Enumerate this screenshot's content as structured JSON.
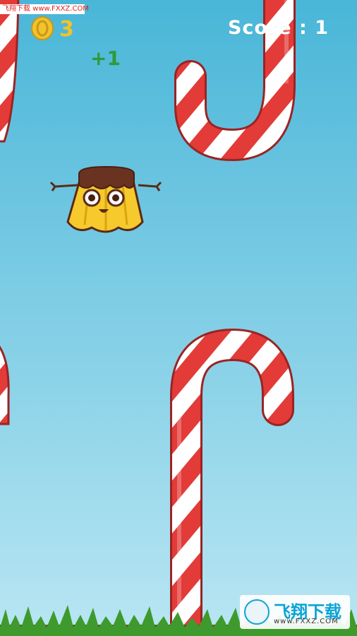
{
  "hud": {
    "coins": "3",
    "score": "Score : 1",
    "bonus": "+1"
  },
  "watermark": {
    "top_text": "飞翔下载 www.FXXZ.COM",
    "brand": "飞翔下载",
    "url": "www.FXXZ.COM"
  },
  "colors": {
    "sky_top": "#49b6d8",
    "sky_bottom": "#b9e6f3",
    "cane_red": "#e23b38",
    "cane_white": "#ffffff",
    "cane_outline": "#9a2424",
    "pudding": "#f6c92d",
    "caramel": "#5a2a18",
    "grass": "#3f9a2d",
    "soil": "#6b4a2a",
    "coin": "#f2c32a"
  },
  "icons": {
    "coin": "coin-icon",
    "player": "pudding-character",
    "obstacle": "candy-cane"
  }
}
